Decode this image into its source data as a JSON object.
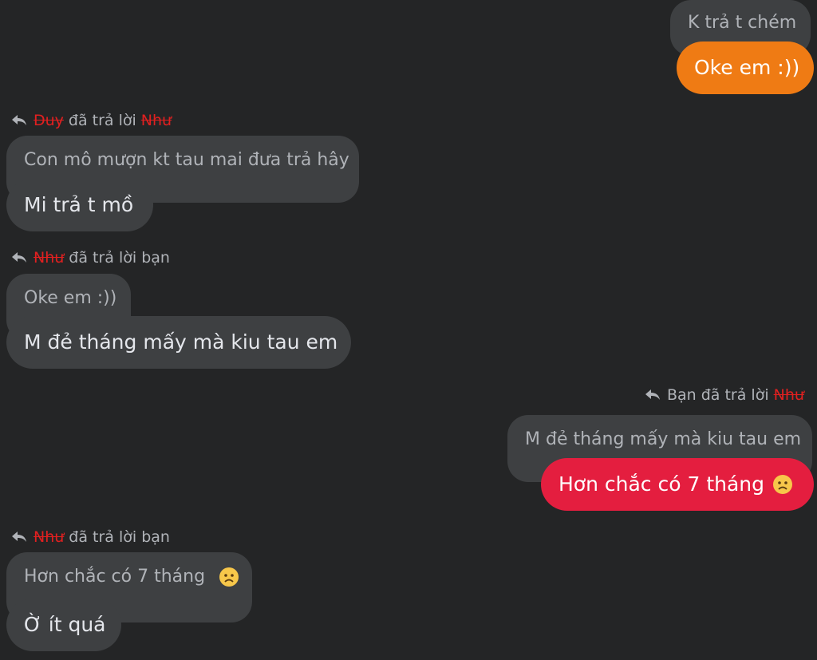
{
  "messages": [
    {
      "quote": "K trả t chém",
      "text": "Oke em :))"
    },
    {
      "reply": {
        "sender": "Duy",
        "verb": "đã trả lời",
        "target": "Như"
      },
      "quote": "Con mô mượn kt tau mai đưa trả hây",
      "text": "Mi trả t mồ"
    },
    {
      "reply": {
        "sender": "Như",
        "verb": "đã trả lời bạn"
      },
      "quote": "Oke em :))",
      "text": "M đẻ tháng mấy mà kiu tau em"
    },
    {
      "reply": {
        "sender": "Bạn",
        "verb": "đã trả lời",
        "target": "Như"
      },
      "quote": "M đẻ tháng mấy mà kiu tau em",
      "text": "Hơn chắc có 7 tháng"
    },
    {
      "reply": {
        "sender": "Như",
        "verb": "đã trả lời bạn"
      },
      "quote": "Hơn chắc có 7 tháng",
      "text": "Ờ ít quá"
    }
  ],
  "colors": {
    "background": "#242526",
    "incoming_bubble": "#3e4042",
    "outgoing_orange": "#ef7b14",
    "outgoing_red": "#e41e3f",
    "redaction": "#e02020"
  },
  "icons": {
    "reply": "reply-arrow-icon",
    "emoji": "frowning-face-icon"
  }
}
